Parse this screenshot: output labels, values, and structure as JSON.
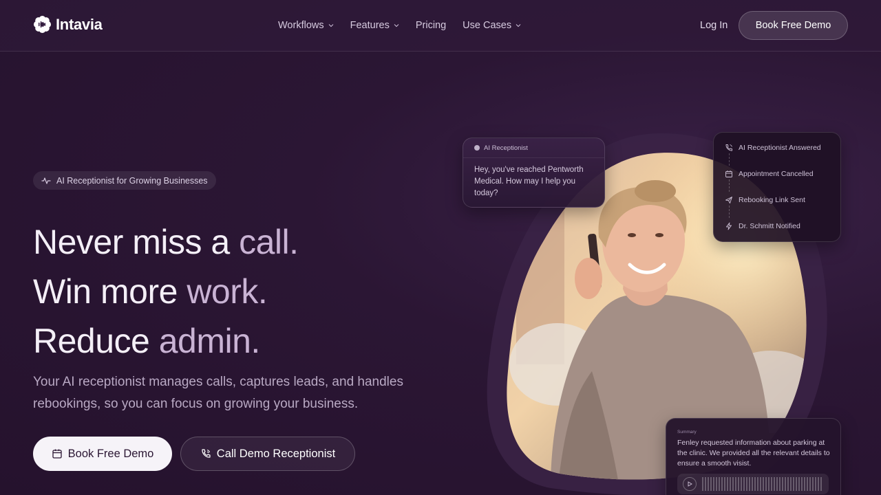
{
  "brand": {
    "name": "Intavia"
  },
  "nav": {
    "items": [
      {
        "label": "Workflows",
        "has_dropdown": true
      },
      {
        "label": "Features",
        "has_dropdown": true
      },
      {
        "label": "Pricing",
        "has_dropdown": false
      },
      {
        "label": "Use Cases",
        "has_dropdown": true
      }
    ],
    "login_label": "Log In",
    "cta_label": "Book Free Demo"
  },
  "hero": {
    "badge": "AI Receptionist for Growing Businesses",
    "headline": [
      {
        "a": "Never miss a ",
        "b": "call."
      },
      {
        "a": "Win more ",
        "b": "work."
      },
      {
        "a": "Reduce ",
        "b": "admin."
      }
    ],
    "subheadline": "Your AI receptionist manages calls, captures leads, and handles rebookings, so you can focus on growing your business.",
    "primary_cta": "Book Free Demo",
    "secondary_cta": "Call Demo Receptionist"
  },
  "chat_card": {
    "title": "AI Receptionist",
    "message": "Hey, you've reached Pentworth Medical. How may I help you today?"
  },
  "events": [
    {
      "label": "AI Receptionist Answered",
      "icon": "phone-icon"
    },
    {
      "label": "Appointment Cancelled",
      "icon": "calendar-icon"
    },
    {
      "label": "Rebooking Link Sent",
      "icon": "send-icon"
    },
    {
      "label": "Dr. Schmitt Notified",
      "icon": "bolt-icon"
    }
  ],
  "summary_card": {
    "label": "Summary",
    "text": "Fenley requested information about parking at the clinic. We provided all the relevant details to ensure a smooth visist."
  },
  "colors": {
    "background": "#2b1634",
    "headline_primary": "#f4eff7",
    "headline_accent": "#c9b3d4",
    "button_light": "#f6f3f8"
  }
}
